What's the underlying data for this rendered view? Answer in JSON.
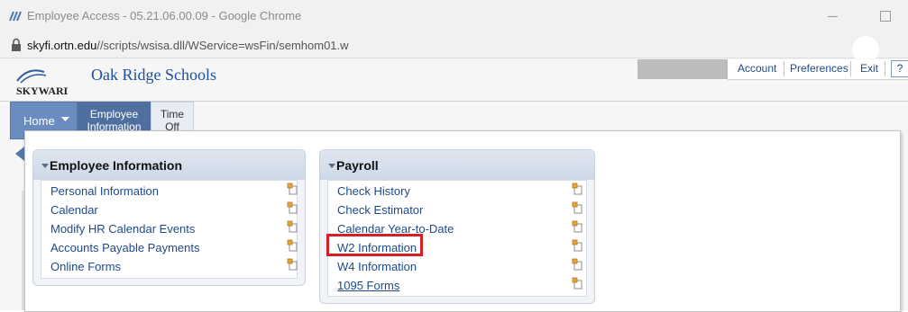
{
  "browser": {
    "window_title": "Employee Access - 05.21.06.00.09 - Google Chrome",
    "url_host": "skyfi.ortn.edu",
    "url_path": "//scripts/wsisa.dll/WService=wsFin/semhom01.w"
  },
  "header": {
    "logo_text": "SKYWARD",
    "district": "Oak Ridge Schools",
    "links": {
      "account": "Account",
      "preferences": "Preferences",
      "exit": "Exit",
      "help": "?"
    }
  },
  "tabs": {
    "home": "Home",
    "employee_line1": "Employee",
    "employee_line2": "Information",
    "time_line1": "Time",
    "time_line2": "Off"
  },
  "employee_info": {
    "title": "Employee Information",
    "items": [
      "Personal Information",
      "Calendar",
      "Modify HR Calendar Events",
      "Accounts Payable Payments",
      "Online Forms"
    ]
  },
  "payroll": {
    "title": "Payroll",
    "items": [
      "Check History",
      "Check Estimator",
      "Calendar Year-to-Date",
      "W2 Information",
      "W4 Information",
      "1095 Forms"
    ]
  },
  "colors": {
    "accent": "#1d4a8a",
    "tab_active": "#4f6f9f",
    "highlight": "#d41f26"
  },
  "icons": {
    "item_icon": "new-window-icon",
    "lock": "lock-icon",
    "app": "chrome-app-icon"
  }
}
